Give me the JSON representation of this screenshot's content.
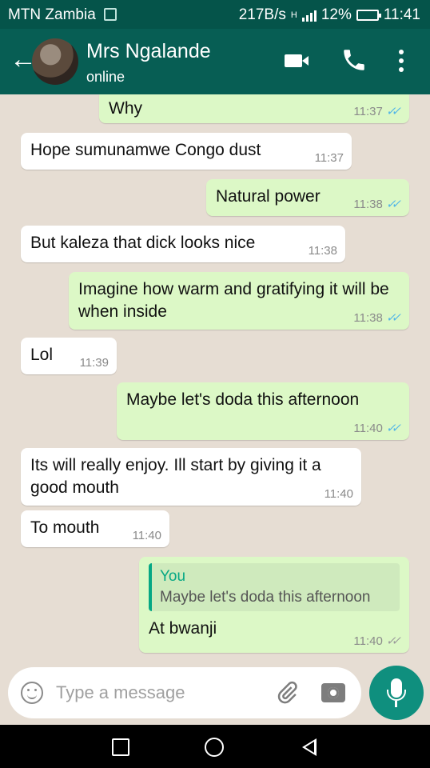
{
  "status_bar": {
    "carrier": "MTN Zambia",
    "speed": "217B/s",
    "network": "H",
    "battery": "12%",
    "time": "11:41"
  },
  "header": {
    "contact_name": "Mrs Ngalande",
    "presence": "online",
    "icons": [
      "back-arrow-icon",
      "avatar",
      "video-call-icon",
      "voice-call-icon",
      "menu-icon"
    ]
  },
  "messages": [
    {
      "direction": "out",
      "text": "Why",
      "time": "11:37",
      "status": "read"
    },
    {
      "direction": "in",
      "text": "Hope sumunamwe Congo dust",
      "time": "11:37"
    },
    {
      "direction": "out",
      "text": "Natural power",
      "time": "11:38",
      "status": "read"
    },
    {
      "direction": "in",
      "text": "But kaleza that dick looks nice",
      "time": "11:38"
    },
    {
      "direction": "out",
      "text": "Imagine how warm and gratifying it will be when inside",
      "time": "11:38",
      "status": "read"
    },
    {
      "direction": "in",
      "text": "Lol",
      "time": "11:39"
    },
    {
      "direction": "out",
      "text": "Maybe let's  doda this afternoon",
      "time": "11:40",
      "status": "read"
    },
    {
      "direction": "in",
      "text": "Its will really enjoy. Ill start by giving it a good mouth",
      "time": "11:40"
    },
    {
      "direction": "in",
      "text": "To mouth",
      "time": "11:40"
    },
    {
      "direction": "out",
      "quote_author": "You",
      "quote_text": "Maybe let's  doda this afternoon",
      "text": "At bwanji",
      "time": "11:40",
      "status": "delivered"
    }
  ],
  "input": {
    "placeholder": "Type a message",
    "value": ""
  },
  "colors": {
    "header": "#075e54",
    "statusbar": "#05544a",
    "outgoing_bubble": "#dcf8c6",
    "incoming_bubble": "#ffffff",
    "accent": "#0f8f7e",
    "read_ticks": "#4fb4e8"
  }
}
